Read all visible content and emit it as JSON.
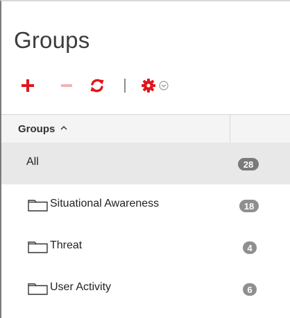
{
  "panel": {
    "title": "Groups"
  },
  "toolbar": {
    "add_icon": "plus-icon",
    "remove_icon": "minus-icon",
    "refresh_icon": "refresh-icon",
    "settings_icon": "gear-icon",
    "dropdown_icon": "chevron-down-circle-icon",
    "colors": {
      "add": "#e0161b",
      "remove_disabled": "#f2b3b5",
      "refresh": "#e0161b",
      "settings": "#e0161b",
      "dropdown": "#9a9a9a"
    }
  },
  "table": {
    "header_label": "Groups",
    "sort_icon": "sort-ascending-icon",
    "rows": [
      {
        "name": "All",
        "count": "28",
        "selected": true,
        "folder": false
      },
      {
        "name": "Situational Awareness",
        "count": "18",
        "selected": false,
        "folder": true
      },
      {
        "name": "Threat",
        "count": "4",
        "selected": false,
        "folder": true
      },
      {
        "name": "User Activity",
        "count": "6",
        "selected": false,
        "folder": true
      }
    ]
  }
}
